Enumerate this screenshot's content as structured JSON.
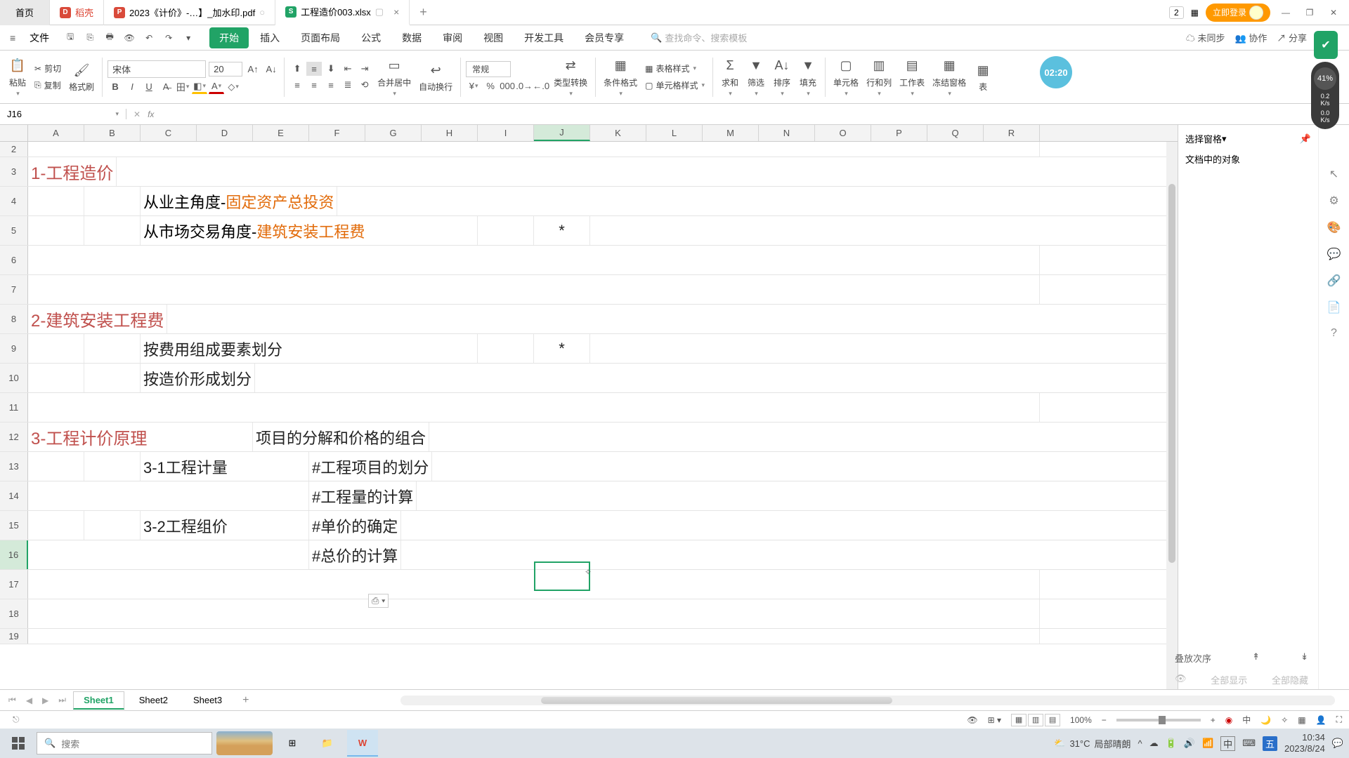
{
  "tabs": {
    "home": "首页",
    "docer": "稻壳",
    "pdf": "2023《计价》-…】_加水印.pdf",
    "xlsx": "工程造价003.xlsx",
    "close": "×",
    "add": "+"
  },
  "win": {
    "num": "2",
    "login": "立即登录",
    "min": "—",
    "max": "❐",
    "close": "✕"
  },
  "menu": {
    "file": "文件",
    "tabs": [
      "开始",
      "插入",
      "页面布局",
      "公式",
      "数据",
      "审阅",
      "视图",
      "开发工具",
      "会员专享"
    ],
    "search_ph": "查找命令、搜索模板",
    "unsync": "未同步",
    "coop": "协作",
    "share": "分享"
  },
  "ribbon": {
    "paste": "粘贴",
    "cut": "剪切",
    "copy": "复制",
    "format_painter": "格式刷",
    "font_name": "宋体",
    "font_size": "20",
    "merge": "合并居中",
    "wrap": "自动换行",
    "number_format": "常规",
    "type_convert": "类型转换",
    "cond_fmt": "条件格式",
    "table_style": "表格样式",
    "cell_style": "单元格样式",
    "sum": "求和",
    "filter": "筛选",
    "sort": "排序",
    "fill": "填充",
    "cell": "单元格",
    "rowcol": "行和列",
    "worksheet": "工作表",
    "freeze": "冻结窗格",
    "table": "表"
  },
  "timer": "02:20",
  "perf": {
    "pct": "41%",
    "v1": "0.2",
    "u1": "K/s",
    "v2": "0.0",
    "u2": "K/s"
  },
  "fbar": {
    "cell_ref": "J16",
    "fx": "fx"
  },
  "cols": [
    "A",
    "B",
    "C",
    "D",
    "E",
    "F",
    "G",
    "H",
    "I",
    "J",
    "K",
    "L",
    "M",
    "N",
    "O",
    "P",
    "Q",
    "R"
  ],
  "rows": [
    "2",
    "3",
    "4",
    "5",
    "6",
    "7",
    "8",
    "9",
    "10",
    "11",
    "12",
    "13",
    "14",
    "15",
    "16",
    "17",
    "18",
    "19"
  ],
  "cells": {
    "r3a": "1-工程造价",
    "r4c_pre": "从业主角度-",
    "r4c_hl": "固定资产总投资",
    "r5c_pre": "从市场交易角度-",
    "r5c_hl": "建筑安装工程费",
    "r5j": "*",
    "r8a": "2-建筑安装工程费",
    "r9c": "按费用组成要素划分",
    "r9j": "*",
    "r10c": "按造价形成划分",
    "r12a": "3-工程计价原理",
    "r12e": "项目的分解和价格的组合",
    "r13c": "3-1工程计量",
    "r13f": "#工程项目的划分",
    "r14f": "#工程量的计算",
    "r15c": "3-2工程组价",
    "r15f": "#单价的确定",
    "r16f": "#总价的计算"
  },
  "side": {
    "pane_title": "选择窗格",
    "objects": "文档中的对象",
    "stack": "叠放次序",
    "show_all": "全部显示",
    "hide_all": "全部隐藏",
    "more": "⋯"
  },
  "sheets": {
    "s1": "Sheet1",
    "s2": "Sheet2",
    "s3": "Sheet3"
  },
  "status": {
    "zoom": "100%"
  },
  "taskbar": {
    "search": "搜索",
    "weather_temp": "31°C",
    "weather_txt": "局部晴朗",
    "ime1": "中",
    "ime2": "五",
    "time": "10:34",
    "date": "2023/8/24"
  }
}
